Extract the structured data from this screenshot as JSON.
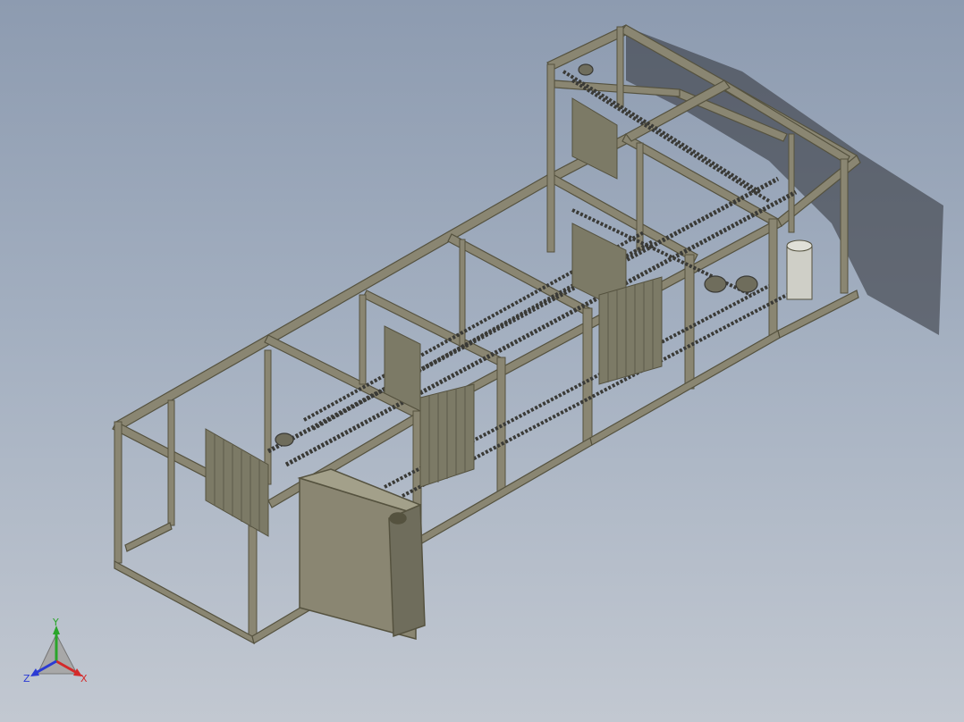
{
  "viewport": {
    "background_top": "#8d9bb0",
    "background_bottom": "#c2c8d1"
  },
  "model": {
    "frame_color": "#8a8672",
    "frame_dark": "#55523f",
    "plate_color": "#7c7a66",
    "chain_color": "#3a3a36",
    "shadow_color": "#2e3035"
  },
  "triad": {
    "x_label": "X",
    "y_label": "Y",
    "z_label": "Z",
    "x_color": "#d42a2a",
    "y_color": "#2aa52a",
    "z_color": "#2a3ad4",
    "icons": [
      "coordinate-triad-icon"
    ]
  }
}
